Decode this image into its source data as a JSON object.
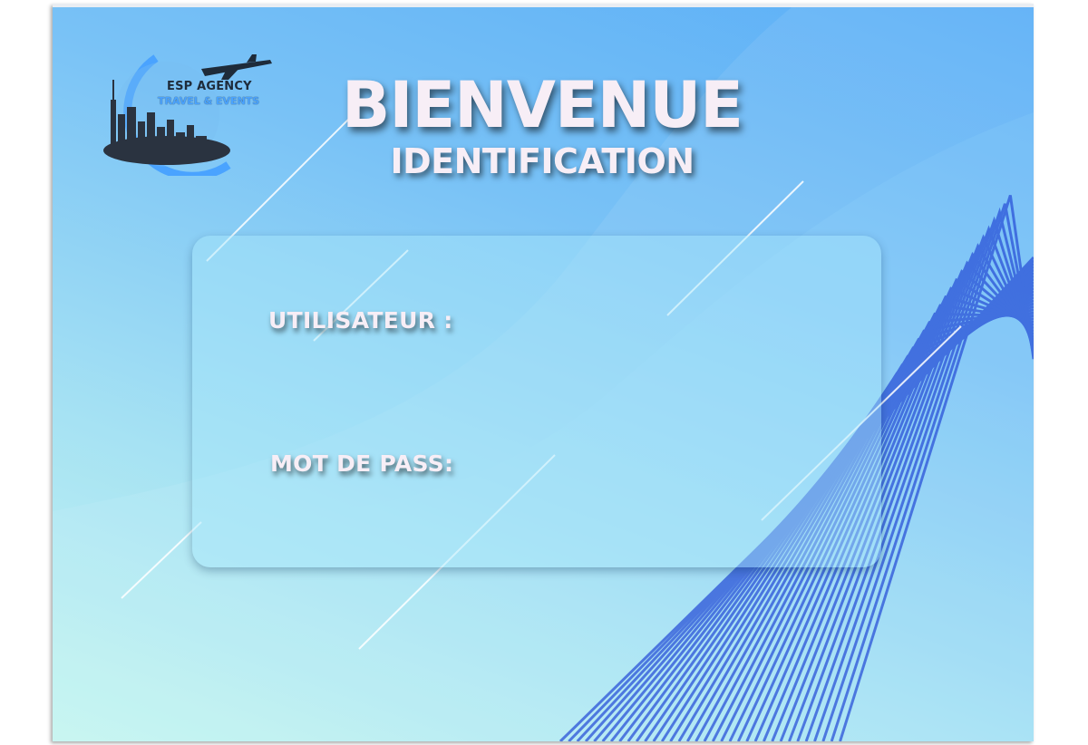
{
  "logo": {
    "title": "ESP AGENCY",
    "subtitle": "TRAVEL & EVENTS",
    "icons": [
      "city-skyline-icon",
      "airplane-icon"
    ]
  },
  "heading": {
    "title": "BIENVENUE",
    "subtitle": "IDENTIFICATION"
  },
  "form": {
    "username_label": "UTILISATEUR :",
    "username_value": "",
    "password_label": "MOT DE PASS:",
    "password_value": ""
  },
  "colors": {
    "background_top": "#5aaef7",
    "background_bottom": "#c8f7ef",
    "stripe": "#2b53d8",
    "text": "#f7eef6"
  }
}
